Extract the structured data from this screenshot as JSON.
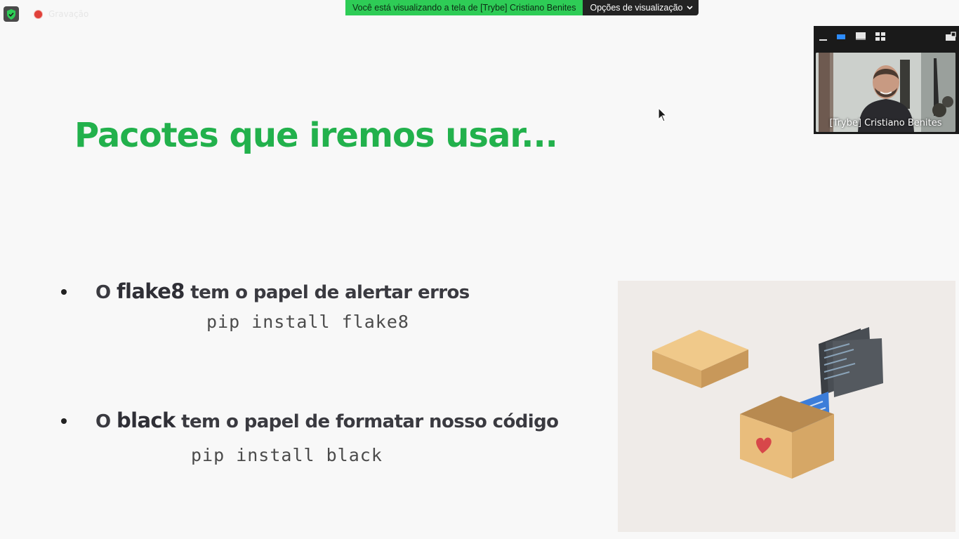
{
  "zoom_bar": {
    "recording_label": "Gravação",
    "share_notice": "Você está visualizando a tela de [Trybe] Cristiano Benites",
    "view_options_label": "Opções de visualização"
  },
  "video_panel": {
    "participant_name": "[Trybe] Cristiano Benites",
    "accent_color": "#2d8cff"
  },
  "slide": {
    "title": "Pacotes que iremos usar...",
    "title_color": "#22b14c",
    "bullets": [
      {
        "prefix": "O ",
        "keyword": "flake8",
        "suffix": " tem o papel de alertar erros",
        "command": "pip install flake8"
      },
      {
        "prefix": "O ",
        "keyword": "black",
        "suffix": " tem o papel de formatar nosso código",
        "command": "pip install black"
      }
    ]
  }
}
